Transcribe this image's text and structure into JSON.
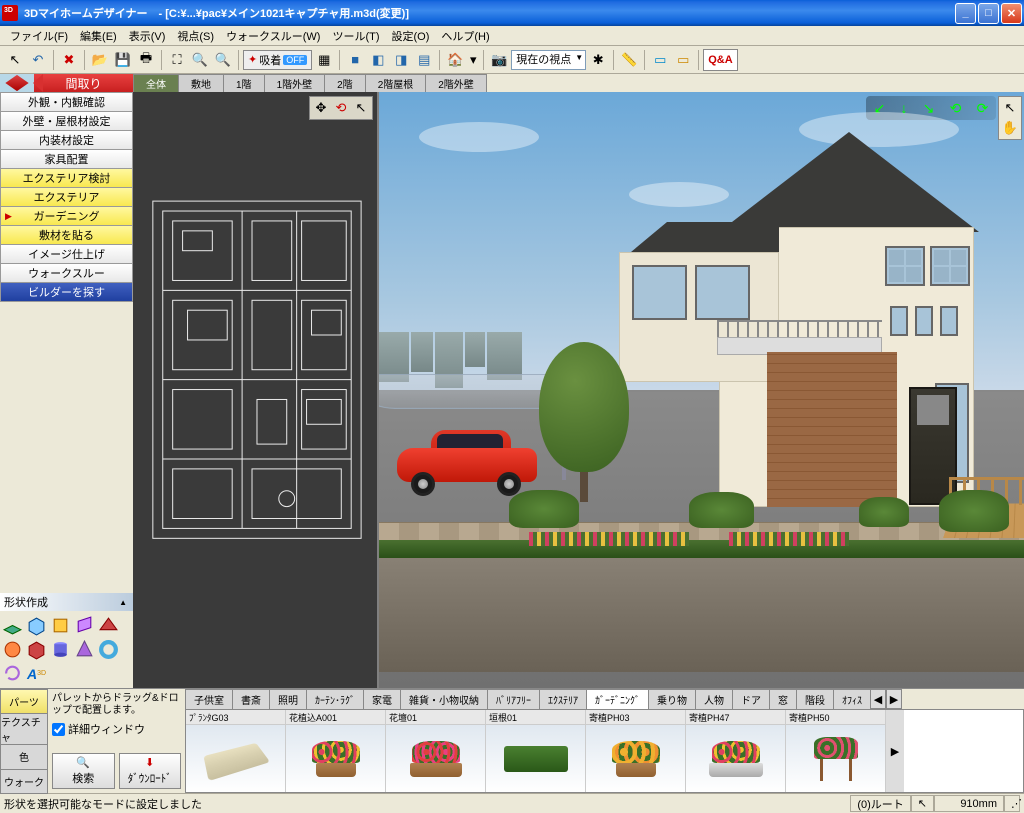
{
  "window": {
    "title": "3Dマイホームデザイナー　- [C:¥...¥pac¥メイン1021キャプチャ用.m3d(変更)]"
  },
  "menu": {
    "file": "ファイル(F)",
    "edit": "編集(E)",
    "view": "表示(V)",
    "viewpoint": "視点(S)",
    "walkthrough": "ウォークスルー(W)",
    "tool": "ツール(T)",
    "settings": "設定(O)",
    "help": "ヘルプ(H)"
  },
  "toolbar": {
    "snap_label": "吸着",
    "snap_state": "OFF",
    "viewpoint_dd": "現在の視点",
    "qa": "Q&A"
  },
  "nav": {
    "madori": "間取り",
    "items": [
      "外観・内観確認",
      "外壁・屋根材設定",
      "内装材設定",
      "家具配置",
      "エクステリア検討",
      "エクステリア",
      "ガーデニング",
      "敷材を貼る",
      "イメージ仕上げ",
      "ウォークスルー",
      "ビルダーを探す"
    ]
  },
  "shape": {
    "title": "形状作成"
  },
  "floor_tabs": [
    "全体",
    "敷地",
    "1階",
    "1階外壁",
    "2階",
    "2階屋根",
    "2階外壁"
  ],
  "palette": {
    "tabs": [
      "パーツ",
      "テクスチャ",
      "色",
      "ウォーク"
    ],
    "hint": "パレットからドラッグ&ドロップで配置します。",
    "detail_check": "詳細ウィンドウ",
    "search": "検索",
    "download": "ﾀﾞｳﾝﾛｰﾄﾞ",
    "cat_tabs": [
      "子供室",
      "書斎",
      "照明",
      "ｶｰﾃﾝ･ﾗｸﾞ",
      "家電",
      "雑貨・小物収納",
      "ﾊﾞﾘｱﾌﾘｰ",
      "ｴｸｽﾃﾘｱ",
      "ｶﾞｰﾃﾞﾆﾝｸﾞ",
      "乗り物",
      "人物",
      "ドア",
      "窓",
      "階段",
      "ｵﾌｨｽ"
    ],
    "thumbs": [
      "ﾌﾟﾗﾝﾀG03",
      "花植込A001",
      "花壇01",
      "垣根01",
      "寄植PH03",
      "寄植PH47",
      "寄植PH50"
    ]
  },
  "status": {
    "msg": "形状を選択可能なモードに設定しました",
    "root": "(0)ルート",
    "dim": "910mm"
  }
}
